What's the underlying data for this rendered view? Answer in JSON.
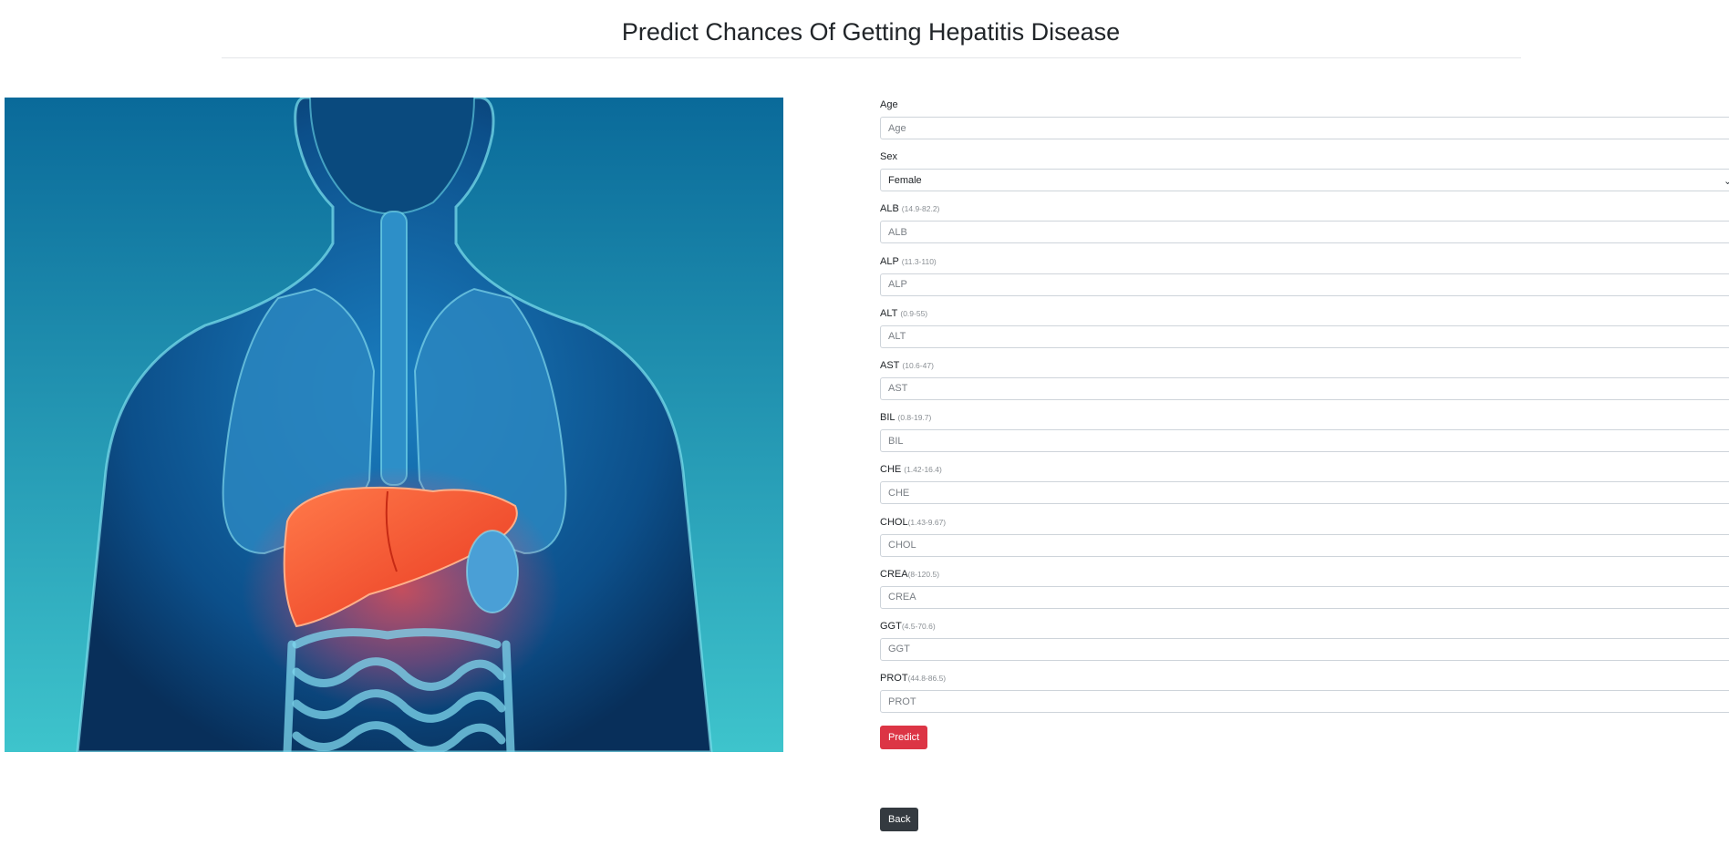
{
  "header": {
    "title": "Predict Chances Of Getting Hepatitis Disease"
  },
  "hero_image": {
    "icon": "anatomy-liver-illustration"
  },
  "form": {
    "age": {
      "label": "Age",
      "placeholder": "Age"
    },
    "sex": {
      "label": "Sex",
      "selected": "Female"
    },
    "fields": [
      {
        "label": "ALB",
        "range": "(14.9-82.2)",
        "placeholder": "ALB"
      },
      {
        "label": "ALP",
        "range": "(11.3-110)",
        "placeholder": "ALP"
      },
      {
        "label": "ALT",
        "range": "(0.9-55)",
        "placeholder": "ALT"
      },
      {
        "label": "AST",
        "range": "(10.6-47)",
        "placeholder": "AST"
      },
      {
        "label": "BIL",
        "range": "(0.8-19.7)",
        "placeholder": "BIL"
      },
      {
        "label": "CHE",
        "range": "(1.42-16.4)",
        "placeholder": "CHE"
      },
      {
        "label": "CHOL",
        "range": "(1.43-9.67)",
        "placeholder": "CHOL"
      },
      {
        "label": "CREA",
        "range": "(8-120.5)",
        "placeholder": "CREA"
      },
      {
        "label": "GGT",
        "range": "(4.5-70.6)",
        "placeholder": "GGT"
      },
      {
        "label": "PROT",
        "range": "(44.8-86.5)",
        "placeholder": "PROT"
      }
    ]
  },
  "buttons": {
    "predict": "Predict",
    "back": "Back"
  },
  "colors": {
    "predict": "#dc3545",
    "back": "#343a40",
    "liver": "#f0502a"
  }
}
